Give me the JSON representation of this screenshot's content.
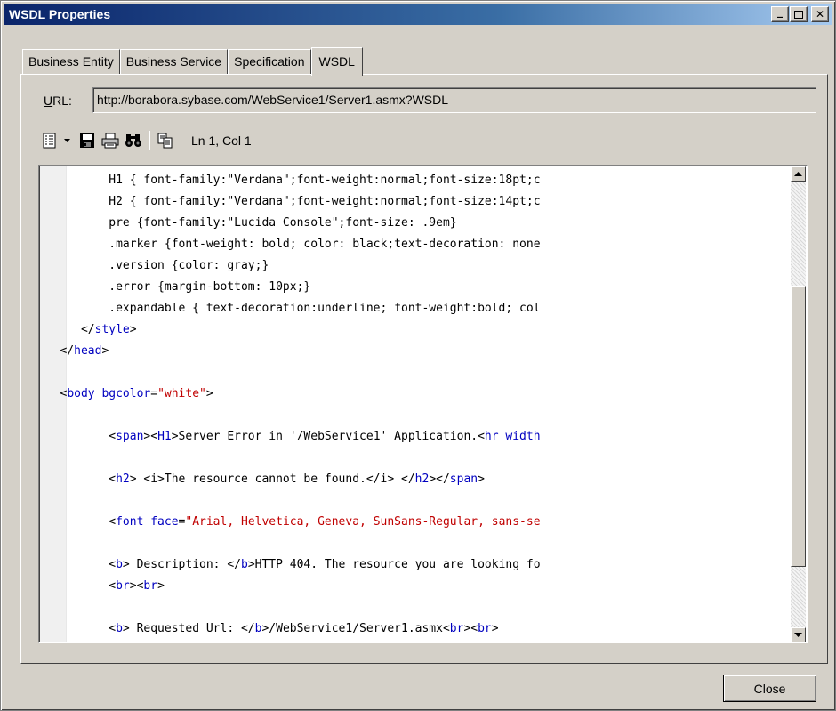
{
  "window": {
    "title": "WSDL Properties"
  },
  "tabs": [
    {
      "label": "Business Entity"
    },
    {
      "label": "Business Service"
    },
    {
      "label": "Specification"
    },
    {
      "label": "WSDL"
    }
  ],
  "url": {
    "label_prefix": "U",
    "label_rest": "RL:",
    "value": "http://borabora.sybase.com/WebService1/Server1.asmx?WSDL"
  },
  "toolbar": {
    "cursor_position": "Ln 1, Col 1"
  },
  "icons": [
    "view-menu-icon",
    "dropdown-arrow-icon",
    "save-icon",
    "print-icon",
    "find-icon",
    "copy-icon"
  ],
  "colors": {
    "title_start": "#0a246a",
    "title_end": "#a6caf0",
    "tag": "#0000c0",
    "string": "#c00000"
  },
  "code_lines": [
    [
      {
        "t": "t",
        "v": "          H1 { font-family:\"Verdana\";font-weight:normal;font-size:18pt;c"
      }
    ],
    [
      {
        "t": "t",
        "v": "          H2 { font-family:\"Verdana\";font-weight:normal;font-size:14pt;c"
      }
    ],
    [
      {
        "t": "t",
        "v": "          pre {font-family:\"Lucida Console\";font-size: .9em}"
      }
    ],
    [
      {
        "t": "t",
        "v": "          .marker {font-weight: bold; color: black;text-decoration: none"
      }
    ],
    [
      {
        "t": "t",
        "v": "          .version {color: gray;}"
      }
    ],
    [
      {
        "t": "t",
        "v": "          .error {margin-bottom: 10px;}"
      }
    ],
    [
      {
        "t": "t",
        "v": "          .expandable { text-decoration:underline; font-weight:bold; col"
      }
    ],
    [
      {
        "t": "t",
        "v": "      </"
      },
      {
        "t": "tag",
        "v": "style"
      },
      {
        "t": "t",
        "v": ">"
      }
    ],
    [
      {
        "t": "t",
        "v": "   </"
      },
      {
        "t": "tag",
        "v": "head"
      },
      {
        "t": "t",
        "v": ">"
      }
    ],
    [
      {
        "t": "t",
        "v": ""
      }
    ],
    [
      {
        "t": "t",
        "v": "   <"
      },
      {
        "t": "tag",
        "v": "body bgcolor"
      },
      {
        "t": "t",
        "v": "="
      },
      {
        "t": "str",
        "v": "\"white\""
      },
      {
        "t": "t",
        "v": ">"
      }
    ],
    [
      {
        "t": "t",
        "v": ""
      }
    ],
    [
      {
        "t": "t",
        "v": "          <"
      },
      {
        "t": "tag",
        "v": "span"
      },
      {
        "t": "t",
        "v": "><"
      },
      {
        "t": "tag",
        "v": "H1"
      },
      {
        "t": "t",
        "v": ">Server Error in '/WebService1' Application.<"
      },
      {
        "t": "tag",
        "v": "hr width"
      }
    ],
    [
      {
        "t": "t",
        "v": ""
      }
    ],
    [
      {
        "t": "t",
        "v": "          <"
      },
      {
        "t": "tag",
        "v": "h2"
      },
      {
        "t": "t",
        "v": "> <i>The resource cannot be found.</i> </"
      },
      {
        "t": "tag",
        "v": "h2"
      },
      {
        "t": "t",
        "v": "></"
      },
      {
        "t": "tag",
        "v": "span"
      },
      {
        "t": "t",
        "v": ">"
      }
    ],
    [
      {
        "t": "t",
        "v": ""
      }
    ],
    [
      {
        "t": "t",
        "v": "          <"
      },
      {
        "t": "tag",
        "v": "font face"
      },
      {
        "t": "t",
        "v": "="
      },
      {
        "t": "str",
        "v": "\"Arial, Helvetica, Geneva, SunSans-Regular, sans-se"
      }
    ],
    [
      {
        "t": "t",
        "v": ""
      }
    ],
    [
      {
        "t": "t",
        "v": "          <"
      },
      {
        "t": "tag",
        "v": "b"
      },
      {
        "t": "t",
        "v": "> Description: </"
      },
      {
        "t": "tag",
        "v": "b"
      },
      {
        "t": "t",
        "v": ">HTTP 404. The resource you are looking fo"
      }
    ],
    [
      {
        "t": "t",
        "v": "          <"
      },
      {
        "t": "tag",
        "v": "br"
      },
      {
        "t": "t",
        "v": "><"
      },
      {
        "t": "tag",
        "v": "br"
      },
      {
        "t": "t",
        "v": ">"
      }
    ],
    [
      {
        "t": "t",
        "v": ""
      }
    ],
    [
      {
        "t": "t",
        "v": "          <"
      },
      {
        "t": "tag",
        "v": "b"
      },
      {
        "t": "t",
        "v": "> Requested Url: </"
      },
      {
        "t": "tag",
        "v": "b"
      },
      {
        "t": "t",
        "v": ">/WebService1/Server1.asmx<"
      },
      {
        "t": "tag",
        "v": "br"
      },
      {
        "t": "t",
        "v": "><"
      },
      {
        "t": "tag",
        "v": "br"
      },
      {
        "t": "t",
        "v": ">"
      }
    ]
  ],
  "buttons": {
    "close": "Close",
    "minimize": "_",
    "maximize": "□",
    "close_x": "✕"
  }
}
